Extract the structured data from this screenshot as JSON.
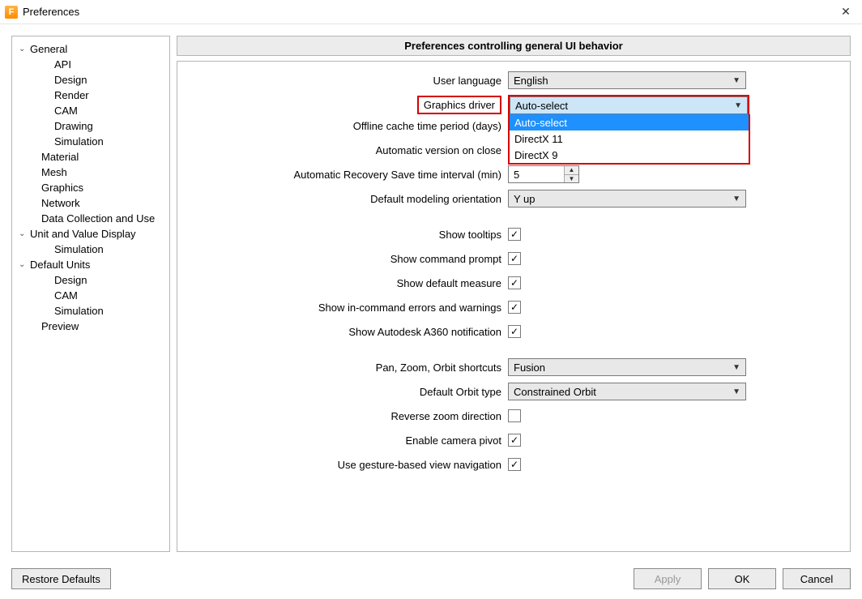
{
  "window": {
    "title": "Preferences",
    "icon_letter": "F"
  },
  "sidebar": {
    "items": [
      {
        "level": 0,
        "exp": true,
        "label": "General"
      },
      {
        "level": 1,
        "exp": null,
        "label": "API"
      },
      {
        "level": 1,
        "exp": null,
        "label": "Design"
      },
      {
        "level": 1,
        "exp": null,
        "label": "Render"
      },
      {
        "level": 1,
        "exp": null,
        "label": "CAM"
      },
      {
        "level": 1,
        "exp": null,
        "label": "Drawing"
      },
      {
        "level": 1,
        "exp": null,
        "label": "Simulation"
      },
      {
        "level": 0,
        "exp": null,
        "label": "Material",
        "sub": true
      },
      {
        "level": 0,
        "exp": null,
        "label": "Mesh",
        "sub": true
      },
      {
        "level": 0,
        "exp": null,
        "label": "Graphics",
        "sub": true
      },
      {
        "level": 0,
        "exp": null,
        "label": "Network",
        "sub": true
      },
      {
        "level": 0,
        "exp": null,
        "label": "Data Collection and Use",
        "sub": true
      },
      {
        "level": 0,
        "exp": true,
        "label": "Unit and Value Display"
      },
      {
        "level": 1,
        "exp": null,
        "label": "Simulation"
      },
      {
        "level": 0,
        "exp": true,
        "label": "Default Units"
      },
      {
        "level": 1,
        "exp": null,
        "label": "Design"
      },
      {
        "level": 1,
        "exp": null,
        "label": "CAM"
      },
      {
        "level": 1,
        "exp": null,
        "label": "Simulation"
      },
      {
        "level": 0,
        "exp": null,
        "label": "Preview",
        "sub": true
      }
    ]
  },
  "section_header": "Preferences controlling general UI behavior",
  "form": {
    "user_language": {
      "label": "User language",
      "value": "English"
    },
    "graphics_driver": {
      "label": "Graphics driver",
      "value": "Auto-select",
      "options": [
        "Auto-select",
        "DirectX 11",
        "DirectX 9"
      ],
      "selected_index": 0
    },
    "offline_cache": {
      "label": "Offline cache time period (days)"
    },
    "auto_version_close": {
      "label": "Automatic version on close"
    },
    "recovery_interval": {
      "label": "Automatic Recovery Save time interval (min)",
      "value": "5"
    },
    "default_orientation": {
      "label": "Default modeling orientation",
      "value": "Y up"
    },
    "show_tooltips": {
      "label": "Show tooltips",
      "checked": true
    },
    "show_cmd_prompt": {
      "label": "Show command prompt",
      "checked": true
    },
    "show_def_measure": {
      "label": "Show default measure",
      "checked": true
    },
    "show_in_cmd_err": {
      "label": "Show in-command errors and warnings",
      "checked": true
    },
    "show_a360": {
      "label": "Show Autodesk A360 notification",
      "checked": true
    },
    "pan_zoom_orbit": {
      "label": "Pan, Zoom, Orbit shortcuts",
      "value": "Fusion"
    },
    "default_orbit": {
      "label": "Default Orbit type",
      "value": "Constrained Orbit"
    },
    "reverse_zoom": {
      "label": "Reverse zoom direction",
      "checked": false
    },
    "enable_cam_pivot": {
      "label": "Enable camera pivot",
      "checked": true
    },
    "gesture_nav": {
      "label": "Use gesture-based view navigation",
      "checked": true
    }
  },
  "buttons": {
    "restore": "Restore Defaults",
    "apply": "Apply",
    "ok": "OK",
    "cancel": "Cancel"
  }
}
